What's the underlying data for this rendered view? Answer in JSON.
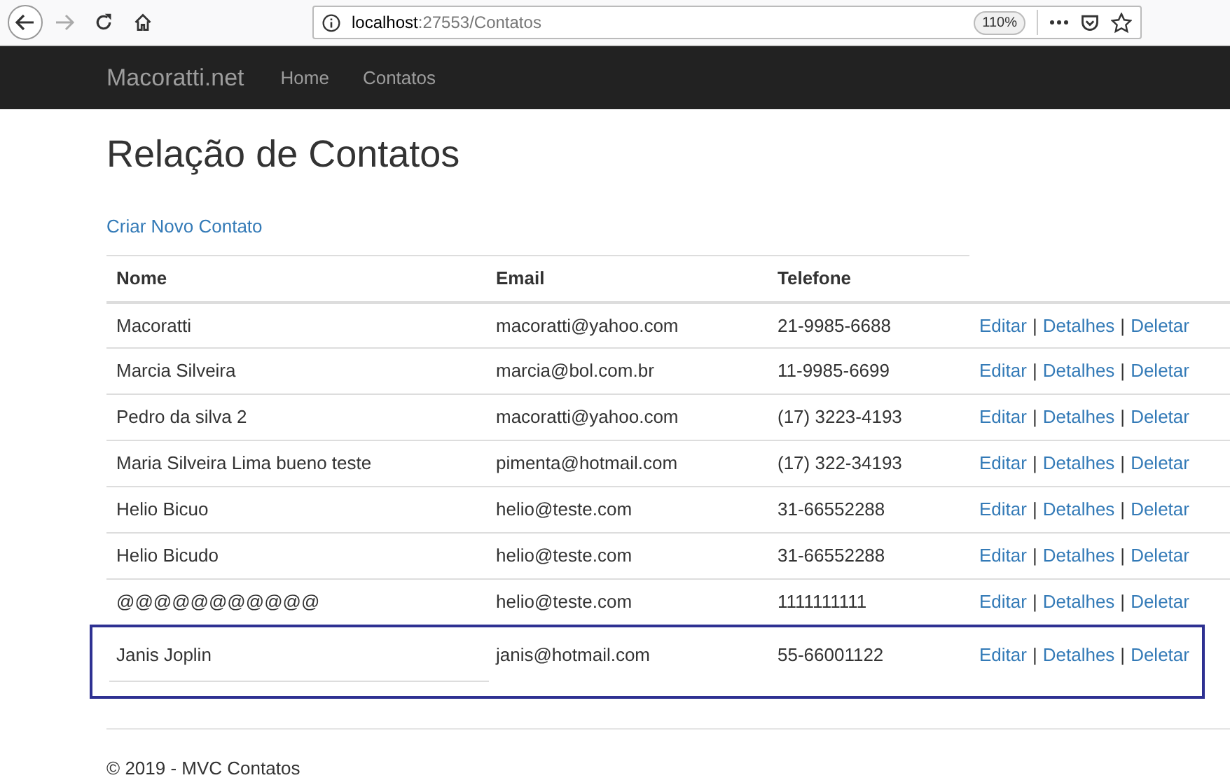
{
  "browser": {
    "url_host": "localhost",
    "url_path": ":27553/Contatos",
    "zoom": "110%"
  },
  "navbar": {
    "brand": "Macoratti.net",
    "links": [
      "Home",
      "Contatos"
    ]
  },
  "page": {
    "title": "Relação de Contatos",
    "create_link": "Criar Novo Contato"
  },
  "table": {
    "columns": [
      "Nome",
      "Email",
      "Telefone"
    ],
    "rows": [
      {
        "nome": "Macoratti",
        "email": "macoratti@yahoo.com",
        "telefone": "21-9985-6688",
        "actions": [
          {
            "kind": "link",
            "text": "Editar"
          },
          {
            "kind": "separator",
            "text": "|"
          },
          {
            "kind": "link",
            "text": "Detalhes"
          },
          {
            "kind": "separator",
            "text": "|"
          },
          {
            "kind": "link",
            "text": "Deletar"
          }
        ],
        "highlighted": false
      },
      {
        "nome": "Marcia Silveira",
        "email": "marcia@bol.com.br",
        "telefone": "11-9985-6699",
        "actions": [
          {
            "kind": "link",
            "text": "Editar"
          },
          {
            "kind": "separator",
            "text": "|"
          },
          {
            "kind": "link",
            "text": "Detalhes"
          },
          {
            "kind": "separator",
            "text": "|"
          },
          {
            "kind": "link",
            "text": "Deletar"
          }
        ],
        "highlighted": false
      },
      {
        "nome": "Pedro da silva 2",
        "email": "macoratti@yahoo.com",
        "telefone": "(17) 3223-4193",
        "actions": [
          {
            "kind": "link",
            "text": "Editar"
          },
          {
            "kind": "separator",
            "text": "|"
          },
          {
            "kind": "link",
            "text": "Detalhes"
          },
          {
            "kind": "separator",
            "text": "|"
          },
          {
            "kind": "link",
            "text": "Deletar"
          }
        ],
        "highlighted": false
      },
      {
        "nome": "Maria Silveira Lima bueno teste",
        "email": "pimenta@hotmail.com",
        "telefone": "(17) 322-34193",
        "actions": [
          {
            "kind": "link",
            "text": "Editar"
          },
          {
            "kind": "separator",
            "text": "|"
          },
          {
            "kind": "link",
            "text": "Detalhes"
          },
          {
            "kind": "separator",
            "text": "|"
          },
          {
            "kind": "link",
            "text": "Deletar"
          }
        ],
        "highlighted": false
      },
      {
        "nome": "Helio Bicuo",
        "email": "helio@teste.com",
        "telefone": "31-66552288",
        "actions": [
          {
            "kind": "link",
            "text": "Editar"
          },
          {
            "kind": "separator",
            "text": "|"
          },
          {
            "kind": "link",
            "text": "Detalhes"
          },
          {
            "kind": "separator",
            "text": "|"
          },
          {
            "kind": "link",
            "text": "Deletar"
          }
        ],
        "highlighted": false
      },
      {
        "nome": "Helio Bicudo",
        "email": "helio@teste.com",
        "telefone": "31-66552288",
        "actions": [
          {
            "kind": "link",
            "text": "Editar"
          },
          {
            "kind": "separator",
            "text": "|"
          },
          {
            "kind": "link",
            "text": "Detalhes"
          },
          {
            "kind": "separator",
            "text": "|"
          },
          {
            "kind": "link",
            "text": "Deletar"
          }
        ],
        "highlighted": false
      },
      {
        "nome": "@@@@@@@@@@@",
        "email": "helio@teste.com",
        "telefone": "1111111111",
        "actions": [
          {
            "kind": "link",
            "text": "Editar"
          },
          {
            "kind": "separator",
            "text": "|"
          },
          {
            "kind": "link",
            "text": "Detalhes"
          },
          {
            "kind": "separator",
            "text": "|"
          },
          {
            "kind": "link",
            "text": "Deletar"
          }
        ],
        "highlighted": false
      },
      {
        "nome": "Janis Joplin",
        "email": "janis@hotmail.com",
        "telefone": "55-66001122",
        "actions": [
          {
            "kind": "link",
            "text": "Editar"
          },
          {
            "kind": "separator",
            "text": "|"
          },
          {
            "kind": "link",
            "text": "Detalhes"
          },
          {
            "kind": "separator",
            "text": "|"
          },
          {
            "kind": "link",
            "text": "Deletar"
          }
        ],
        "highlighted": true
      }
    ]
  },
  "footer": "© 2019 - MVC Contatos"
}
